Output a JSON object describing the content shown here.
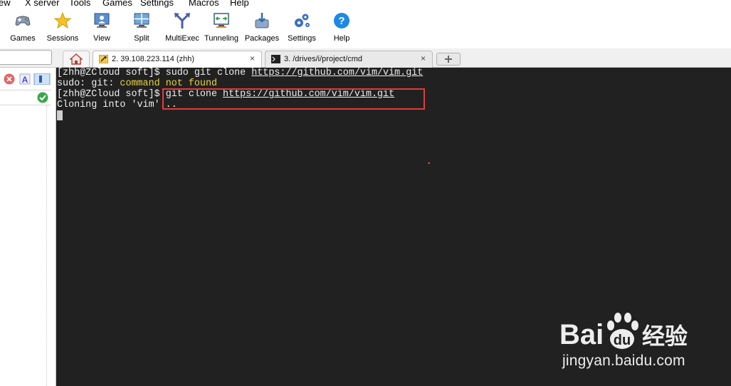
{
  "menubar": {
    "items": [
      "ew",
      "X server",
      "Tools",
      "Games",
      "Settings",
      "Macros",
      "Help"
    ]
  },
  "toolbar": {
    "buttons": [
      {
        "label": "Games",
        "icon": "gamepad-icon"
      },
      {
        "label": "Sessions",
        "icon": "star-icon"
      },
      {
        "label": "View",
        "icon": "monitor-user-icon"
      },
      {
        "label": "Split",
        "icon": "split-screen-icon"
      },
      {
        "label": "MultiExec",
        "icon": "fork-arrow-icon"
      },
      {
        "label": "Tunneling",
        "icon": "tunnel-monitor-icon"
      },
      {
        "label": "Packages",
        "icon": "package-download-icon"
      },
      {
        "label": "Settings",
        "icon": "gears-icon"
      },
      {
        "label": "Help",
        "icon": "question-icon"
      }
    ]
  },
  "tabs": {
    "active": {
      "label": "2. 39.108.223.114 (zhh)",
      "close": "×"
    },
    "inactive": {
      "label": "3. /drives/i/project/cmd",
      "close": "×"
    }
  },
  "terminal": {
    "line1": {
      "prompt": "[zhh@ZCloud soft]$ ",
      "cmd": "sudo git clone ",
      "url": "https://github.com/vim/vim.git"
    },
    "line2": {
      "prefix": "sudo: git: ",
      "highlight": "command not found"
    },
    "line3": {
      "prompt": "[zhh@ZCloud soft]$ ",
      "cmd": "git clone ",
      "url": "https://github.com/vim/vim.git"
    },
    "line4": {
      "text": "Cloning into 'vim'..."
    }
  },
  "watermark": {
    "brand_left": "Bai",
    "brand_right": "经验",
    "url": "jingyan.baidu.com"
  },
  "colors": {
    "terminal_bg": "#212121",
    "terminal_fg": "#ededed",
    "highlight_box": "#e33a3a",
    "yellow_text": "#e6d23c"
  }
}
